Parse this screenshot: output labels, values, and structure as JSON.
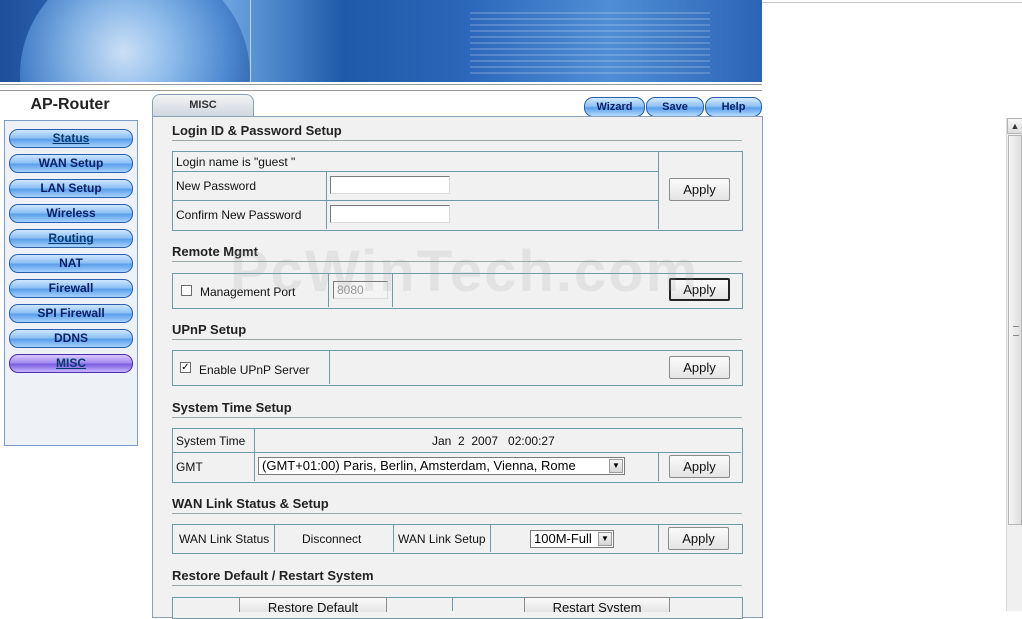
{
  "brand": "AP-Router",
  "nav": [
    {
      "label": "Status",
      "link": true
    },
    {
      "label": "WAN Setup",
      "link": false
    },
    {
      "label": "LAN Setup",
      "link": false
    },
    {
      "label": "Wireless",
      "link": false
    },
    {
      "label": "Routing",
      "link": true
    },
    {
      "label": "NAT",
      "link": false
    },
    {
      "label": "Firewall",
      "link": false
    },
    {
      "label": "SPI Firewall",
      "link": false
    },
    {
      "label": "DDNS",
      "link": false
    },
    {
      "label": "MISC",
      "link": true,
      "active": true
    }
  ],
  "tab_label": "MISC",
  "top_buttons": {
    "wizard": "Wizard",
    "save": "Save",
    "help": "Help"
  },
  "watermark": "PcWinTech.com",
  "apply_label": "Apply",
  "login": {
    "title": "Login ID & Password Setup",
    "login_name": "Login name is \"guest \"",
    "new_password_label": "New Password",
    "confirm_password_label": "Confirm New Password",
    "new_password_value": "",
    "confirm_password_value": ""
  },
  "remote": {
    "title": "Remote Mgmt",
    "management_port_label": "Management Port",
    "management_port_checked": false,
    "port_value": "8080"
  },
  "upnp": {
    "title": "UPnP Setup",
    "enable_label": "Enable UPnP Server",
    "checked": true
  },
  "time": {
    "title": "System Time Setup",
    "system_time_label": "System Time",
    "system_time_value": "Jan  2  2007   02:00:27",
    "gmt_label": "GMT",
    "gmt_selected": "(GMT+01:00) Paris, Berlin, Amsterdam, Vienna, Rome"
  },
  "wan": {
    "title": "WAN Link Status & Setup",
    "status_label": "WAN Link Status",
    "status_value": "Disconnect",
    "setup_label": "WAN Link Setup",
    "setup_selected": "100M-Full"
  },
  "restore": {
    "title": "Restore Default / Restart System",
    "restore_label": "Restore Default",
    "restart_label": "Restart System"
  }
}
